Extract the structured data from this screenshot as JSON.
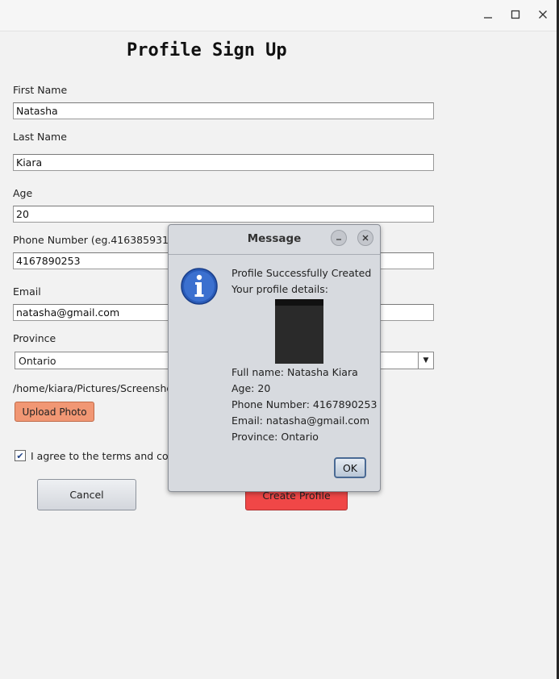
{
  "window": {
    "minimize_icon": "minimize-icon",
    "maximize_icon": "maximize-icon",
    "close_icon": "close-icon"
  },
  "form": {
    "title": "Profile Sign Up",
    "first_name_label": "First Name",
    "first_name_value": "Natasha",
    "last_name_label": "Last Name",
    "last_name_value": "Kiara",
    "age_label": "Age",
    "age_value": "20",
    "phone_label": "Phone Number (eg.4163859310)",
    "phone_value": "4167890253",
    "email_label": "Email",
    "email_value": "natasha@gmail.com",
    "province_label": "Province",
    "province_value": "Ontario",
    "photo_path": "/home/kiara/Pictures/Screenshots/",
    "upload_label": "Upload Photo",
    "agree_label": "I agree to the terms and condit",
    "agree_checked": true,
    "cancel_label": "Cancel",
    "create_label": "Create Profile",
    "upload_color": "#f19774",
    "create_color": "#f04747"
  },
  "dialog": {
    "title": "Message",
    "line1": "Profile Successfully Created",
    "line2": "Your profile details:",
    "full_name": "Full name: Natasha Kiara",
    "age": "Age: 20",
    "phone": "Phone Number: 4167890253",
    "email": "Email: natasha@gmail.com",
    "province": "Province: Ontario",
    "ok_label": "OK",
    "icon": "info-icon"
  }
}
